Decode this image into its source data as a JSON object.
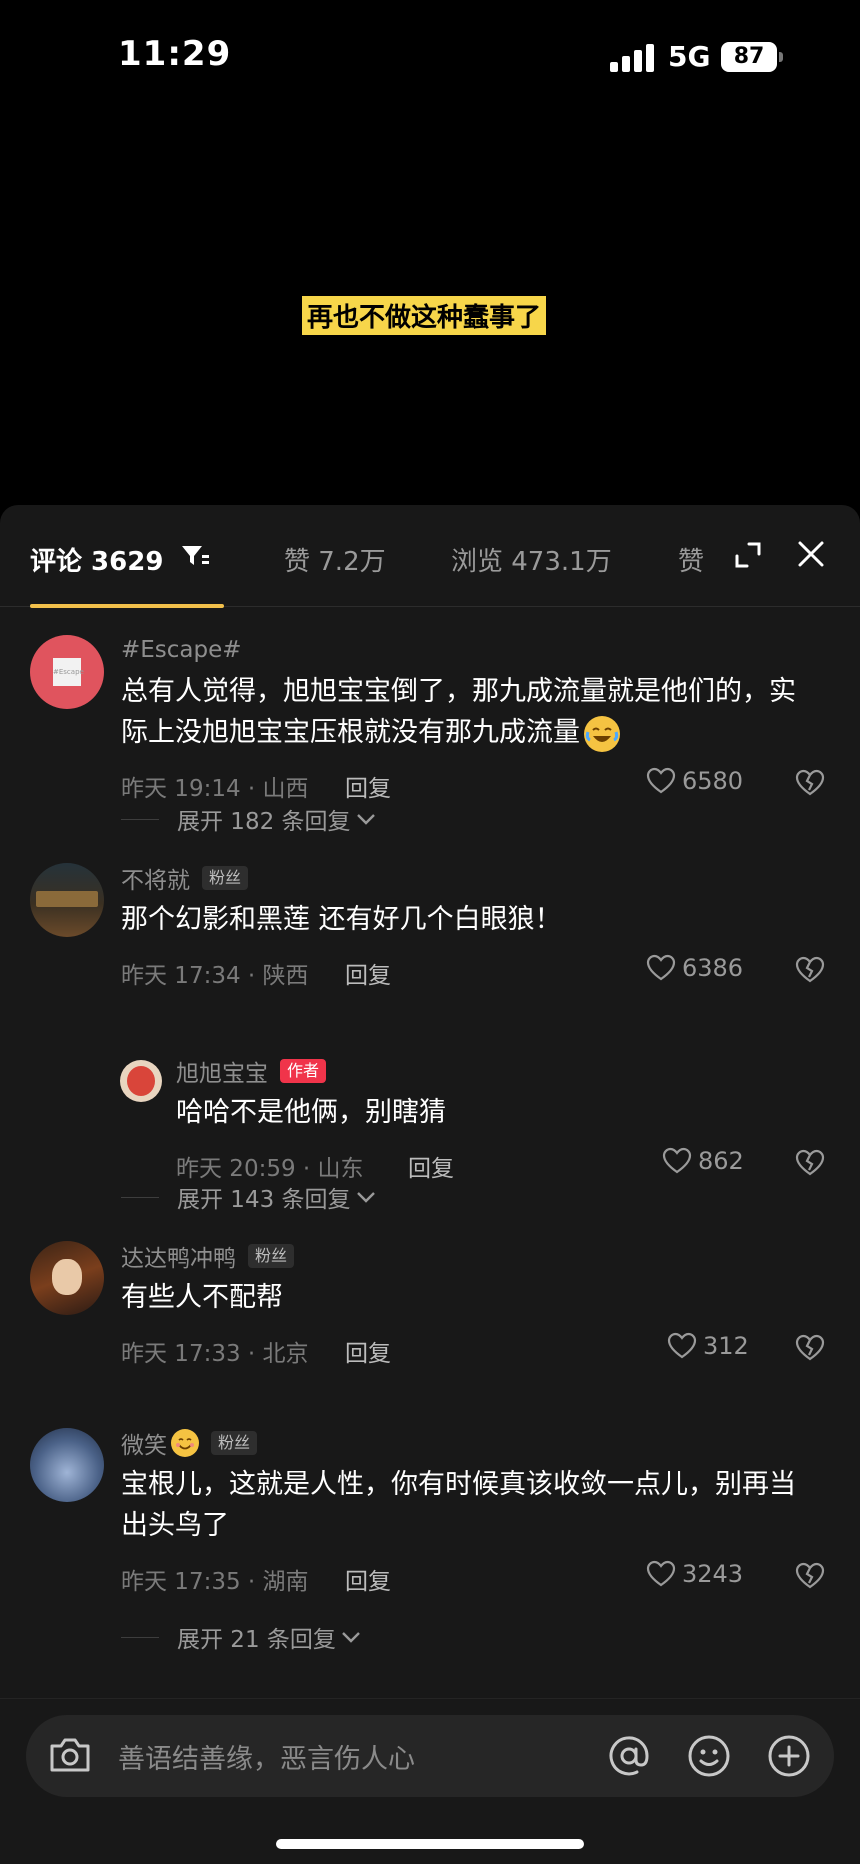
{
  "status": {
    "time": "11:29",
    "network": "5G",
    "battery": "87"
  },
  "video": {
    "subtitle": "再也不做这种蠢事了"
  },
  "tabs": {
    "comments": "评论 3629",
    "likes": "赞 7.2万",
    "views": "浏览 473.1万",
    "more": "赞"
  },
  "comments": [
    {
      "username": "#Escape#",
      "text": "总有人觉得，旭旭宝宝倒了，那九成流量就是他们的，实际上没旭旭宝宝压根就没有那九成流量",
      "time_location": "昨天 19:14 · 山西",
      "reply_label": "回复",
      "likes": "6580",
      "expand": "展开 182 条回复",
      "avatar_text": "#Escape"
    },
    {
      "username": "不将就",
      "badge": "粉丝",
      "text": "那个幻影和黑莲 还有好几个白眼狼！",
      "time_location": "昨天 17:34 · 陕西",
      "reply_label": "回复",
      "likes": "6386",
      "sub_reply": {
        "username": "旭旭宝宝",
        "badge": "作者",
        "text": "哈哈不是他俩，别瞎猜",
        "time_location": "昨天 20:59 · 山东",
        "reply_label": "回复",
        "likes": "862"
      },
      "expand": "展开 143 条回复"
    },
    {
      "username": "达达鸭冲鸭",
      "badge": "粉丝",
      "text": "有些人不配帮",
      "time_location": "昨天 17:33 · 北京",
      "reply_label": "回复",
      "likes": "312"
    },
    {
      "username": "微笑",
      "badge": "粉丝",
      "text": "宝根儿，这就是人性，你有时候真该收敛一点儿，别再当出头鸟了",
      "time_location": "昨天 17:35 · 湖南",
      "reply_label": "回复",
      "likes": "3243",
      "expand": "展开 21 条回复"
    }
  ],
  "input": {
    "placeholder": "善语结善缘，恶言伤人心"
  },
  "colors": {
    "accent": "#f2c04b",
    "author_badge": "#f0344a",
    "subtitle_bg": "#f7d64a"
  }
}
